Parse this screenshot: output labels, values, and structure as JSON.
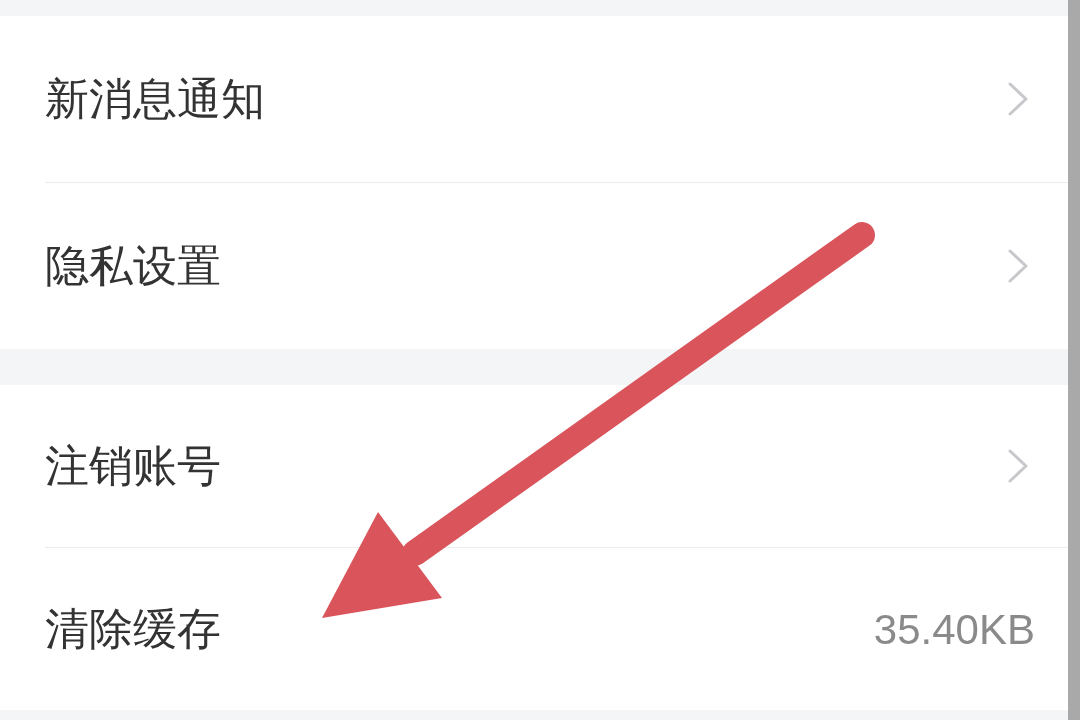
{
  "settings": {
    "groups": [
      {
        "items": [
          {
            "label": "新消息通知",
            "kind": "link"
          },
          {
            "label": "隐私设置",
            "kind": "link"
          }
        ]
      },
      {
        "items": [
          {
            "label": "注销账号",
            "kind": "link"
          },
          {
            "label": "清除缓存",
            "kind": "value",
            "value": "35.40KB"
          }
        ]
      }
    ]
  }
}
